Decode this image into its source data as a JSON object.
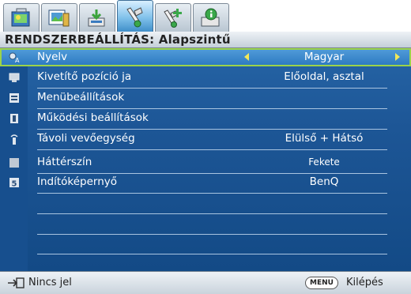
{
  "tabs": [
    {
      "icon": "display-picture-icon",
      "active": false
    },
    {
      "icon": "picture-settings-icon",
      "active": false
    },
    {
      "icon": "source-input-icon",
      "active": false
    },
    {
      "icon": "system-setup-basic-icon",
      "active": true
    },
    {
      "icon": "system-setup-advanced-icon",
      "active": false
    },
    {
      "icon": "information-icon",
      "active": false
    }
  ],
  "menu": {
    "title": "RENDSZERBEÁLLÍTÁS: Alapszintű",
    "rows": [
      {
        "label": "Nyelv",
        "value": "Magyar",
        "icon": "language-icon",
        "selected": true
      },
      {
        "label": "Kivetítő pozíció ja",
        "value": "Előoldal, asztal",
        "icon": "projector-position-icon"
      },
      {
        "label": "Menübeállítások",
        "value": "",
        "icon": "menu-settings-icon"
      },
      {
        "label": "Működési beállítások",
        "value": "",
        "icon": "operation-settings-icon"
      },
      {
        "label": "Távoli vevőegység",
        "value": "Elülső + Hátsó",
        "icon": "remote-receiver-icon"
      },
      {
        "label": "Háttérszín",
        "value": "Fekete",
        "icon": "background-color-icon"
      },
      {
        "label": "Indítóképernyő",
        "value": "BenQ",
        "icon": "splash-screen-icon"
      }
    ]
  },
  "footer": {
    "source_status": "Nincs jel",
    "menu_key": "MENU",
    "exit_label": "Kilépés"
  },
  "colors": {
    "panel_blue": "#1d5696",
    "selection_border": "#9bd34a",
    "arrow_yellow": "#f1e85a"
  }
}
